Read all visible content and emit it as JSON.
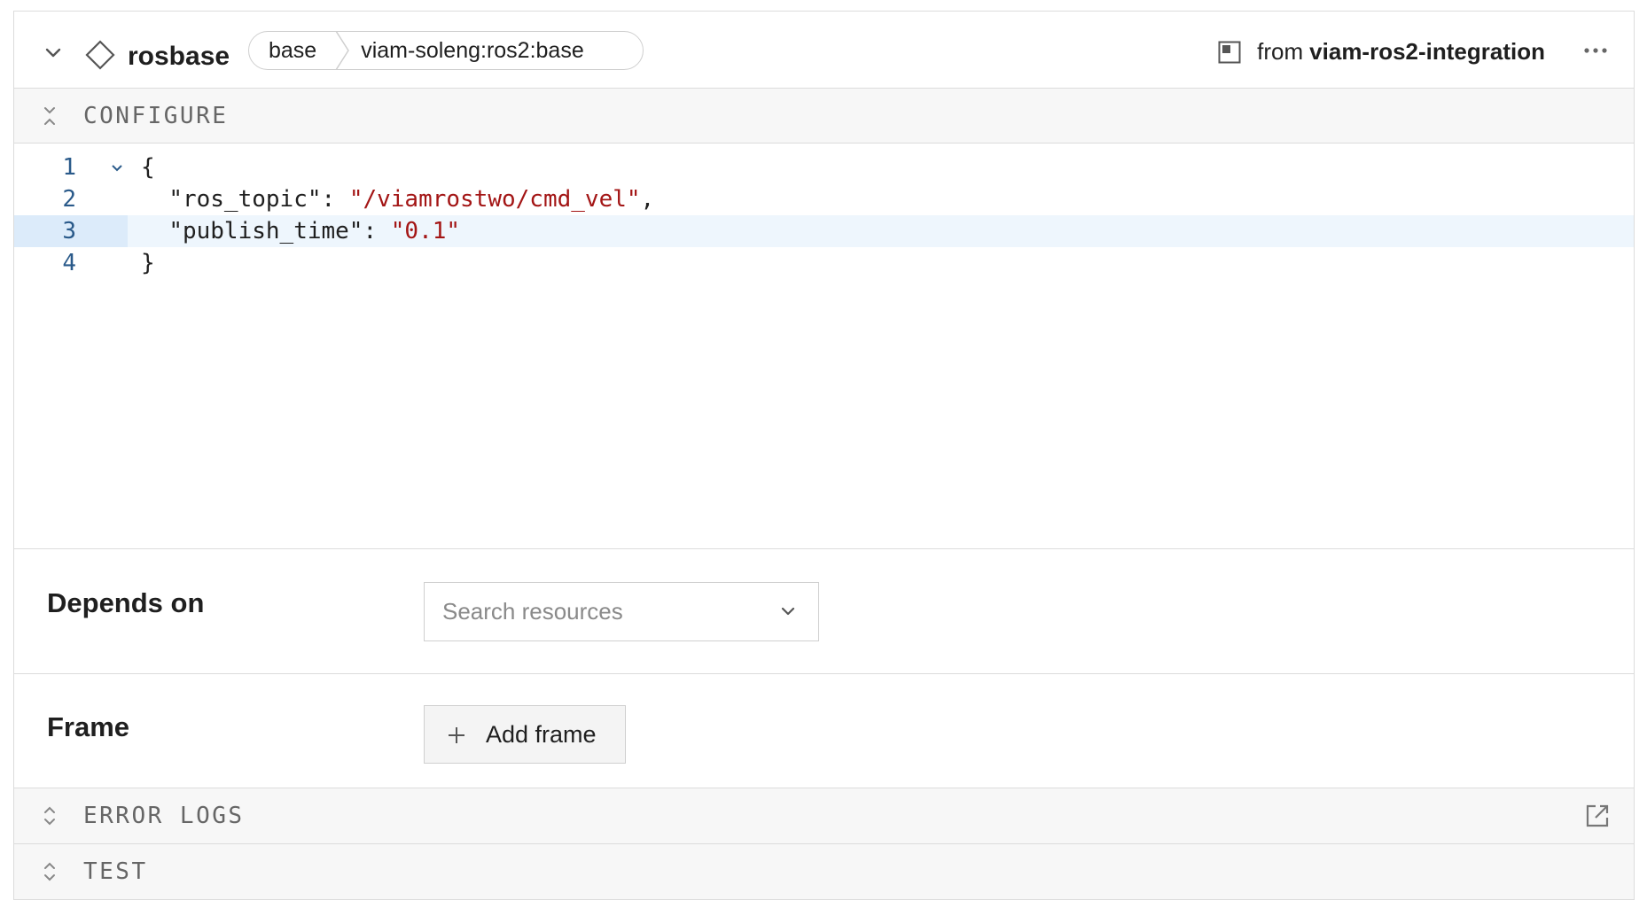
{
  "header": {
    "title": "rosbase",
    "api": "base",
    "model": "viam-soleng:ros2:base",
    "from_label": "from",
    "from_module": "viam-ros2-integration"
  },
  "sections": {
    "configure": "CONFIGURE",
    "error_logs": "ERROR LOGS",
    "test": "TEST"
  },
  "editor": {
    "lines": [
      {
        "num": "1",
        "text": "{"
      },
      {
        "num": "2",
        "key": "\"ros_topic\"",
        "sep": ": ",
        "value": "\"/viamrostwo/cmd_vel\"",
        "trail": ","
      },
      {
        "num": "3",
        "key": "\"publish_time\"",
        "sep": ": ",
        "value": "\"0.1\"",
        "trail": ""
      },
      {
        "num": "4",
        "text": "}"
      }
    ],
    "active_line": "3"
  },
  "depends_on": {
    "label": "Depends on",
    "placeholder": "Search resources"
  },
  "frame": {
    "label": "Frame",
    "button_label": "Add frame"
  },
  "colors": {
    "border": "#dcdcdc",
    "section_bg": "#f7f7f7",
    "string": "#a31515",
    "line_number": "#2a5a8a",
    "active_line_bg": "#eef6fd"
  }
}
